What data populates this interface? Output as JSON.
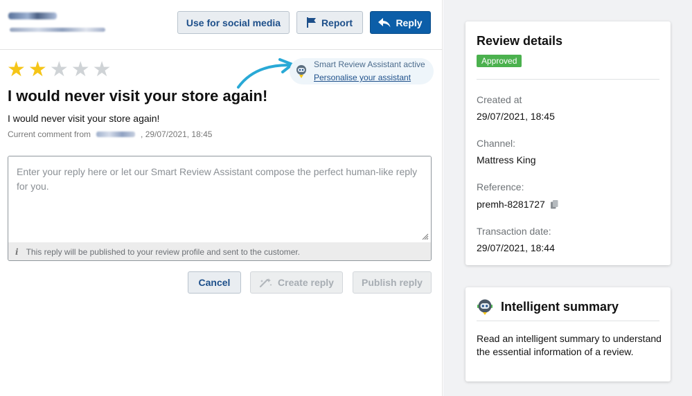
{
  "toolbar": {
    "social_label": "Use for social media",
    "report_label": "Report",
    "reply_label": "Reply"
  },
  "review": {
    "rating": 2,
    "max_rating": 5,
    "title": "I would never visit your store again!",
    "text": "I would never visit your store again!",
    "meta_prefix": "Current comment from",
    "meta_date": ", 29/07/2021, 18:45"
  },
  "assistant": {
    "status": "Smart Review Assistant active",
    "link": "Personalise your assistant"
  },
  "reply_form": {
    "placeholder": "Enter your reply here or let our Smart Review Assistant compose the perfect human-like reply for you.",
    "value": "",
    "footer_note": "This reply will be published to your review profile and sent to the customer.",
    "cancel_label": "Cancel",
    "create_label": "Create reply",
    "publish_label": "Publish reply"
  },
  "details": {
    "title": "Review details",
    "status_badge": "Approved",
    "created_label": "Created at",
    "created_value": "29/07/2021, 18:45",
    "channel_label": "Channel:",
    "channel_value": "Mattress King",
    "reference_label": "Reference:",
    "reference_value": "premh-8281727",
    "transaction_label": "Transaction date:",
    "transaction_value": "29/07/2021, 18:44"
  },
  "summary": {
    "title": "Intelligent summary",
    "text": "Read an intelligent summary to understand the essential information of a review."
  },
  "colors": {
    "primary": "#0c5ea8",
    "star": "#f5c518",
    "approved": "#4bb14e",
    "arrow": "#29a9d6"
  }
}
